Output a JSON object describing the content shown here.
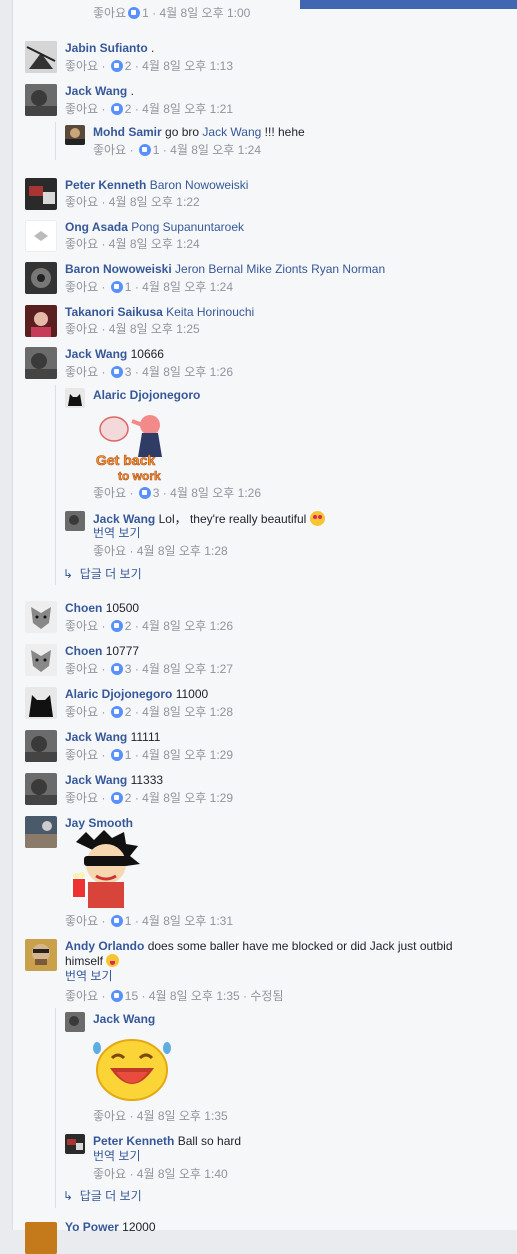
{
  "ui": {
    "like": "좋아요",
    "translate": "번역 보기",
    "more_replies": "답글 더 보기",
    "edited": "수정됨",
    "sep": " · "
  },
  "comments": [
    {
      "meta_top": "1 · 4월 8일 오후 1:00"
    },
    {
      "name": "Jabin Sufianto",
      "text": ".",
      "count": "2",
      "time": "4월 8일 오후 1:13"
    },
    {
      "name": "Jack Wang",
      "text": ".",
      "count": "2",
      "time": "4월 8일 오후 1:21"
    },
    {
      "name": "Mohd Samir",
      "text": "go bro",
      "tag": "Jack Wang",
      "text2": "!!! hehe",
      "count": "1",
      "time": "4월 8일 오후 1:24"
    },
    {
      "name": "Peter Kenneth",
      "tag": "Baron Nowoweiski",
      "time": "4월 8일 오후 1:22"
    },
    {
      "name": "Ong Asada",
      "tag": "Pong Supanuntaroek",
      "time": "4월 8일 오후 1:24"
    },
    {
      "name": "Baron Nowoweiski",
      "tag": "Jeron Bernal Mike Zionts Ryan Norman",
      "count": "1",
      "time": "4월 8일 오후 1:24"
    },
    {
      "name": "Takanori Saikusa",
      "tag": "Keita Horinouchi",
      "time": "4월 8일 오후 1:25"
    },
    {
      "name": "Jack Wang",
      "text": "10666",
      "count": "3",
      "time": "4월 8일 오후 1:26"
    },
    {
      "name": "Alaric Djojonegoro",
      "sticker_text": "Get back to work",
      "count": "3",
      "time": "4월 8일 오후 1:26"
    },
    {
      "name": "Jack Wang",
      "text": "Lol， they're really beautiful",
      "time": "4월 8일 오후 1:28"
    },
    {
      "name": "Choen",
      "text": "10500",
      "count": "2",
      "time": "4월 8일 오후 1:26"
    },
    {
      "name": "Choen",
      "text": "10777",
      "count": "3",
      "time": "4월 8일 오후 1:27"
    },
    {
      "name": "Alaric Djojonegoro",
      "text": "11000",
      "count": "2",
      "time": "4월 8일 오후 1:28"
    },
    {
      "name": "Jack Wang",
      "text": "11111",
      "count": "1",
      "time": "4월 8일 오후 1:29"
    },
    {
      "name": "Jack Wang",
      "text": "11333",
      "count": "2",
      "time": "4월 8일 오후 1:29"
    },
    {
      "name": "Jay Smooth",
      "count": "1",
      "time": "4월 8일 오후 1:31"
    },
    {
      "name": "Andy Orlando",
      "text": "does some baller have me blocked or did Jack just outbid",
      "text2": "himself",
      "count": "15",
      "time": "4월 8일 오후 1:35"
    },
    {
      "name": "Jack Wang",
      "time": "4월 8일 오후 1:35"
    },
    {
      "name": "Peter Kenneth",
      "text": "Ball so hard",
      "time": "4월 8일 오후 1:40"
    },
    {
      "name": "Yo Power",
      "text": "12000"
    }
  ]
}
